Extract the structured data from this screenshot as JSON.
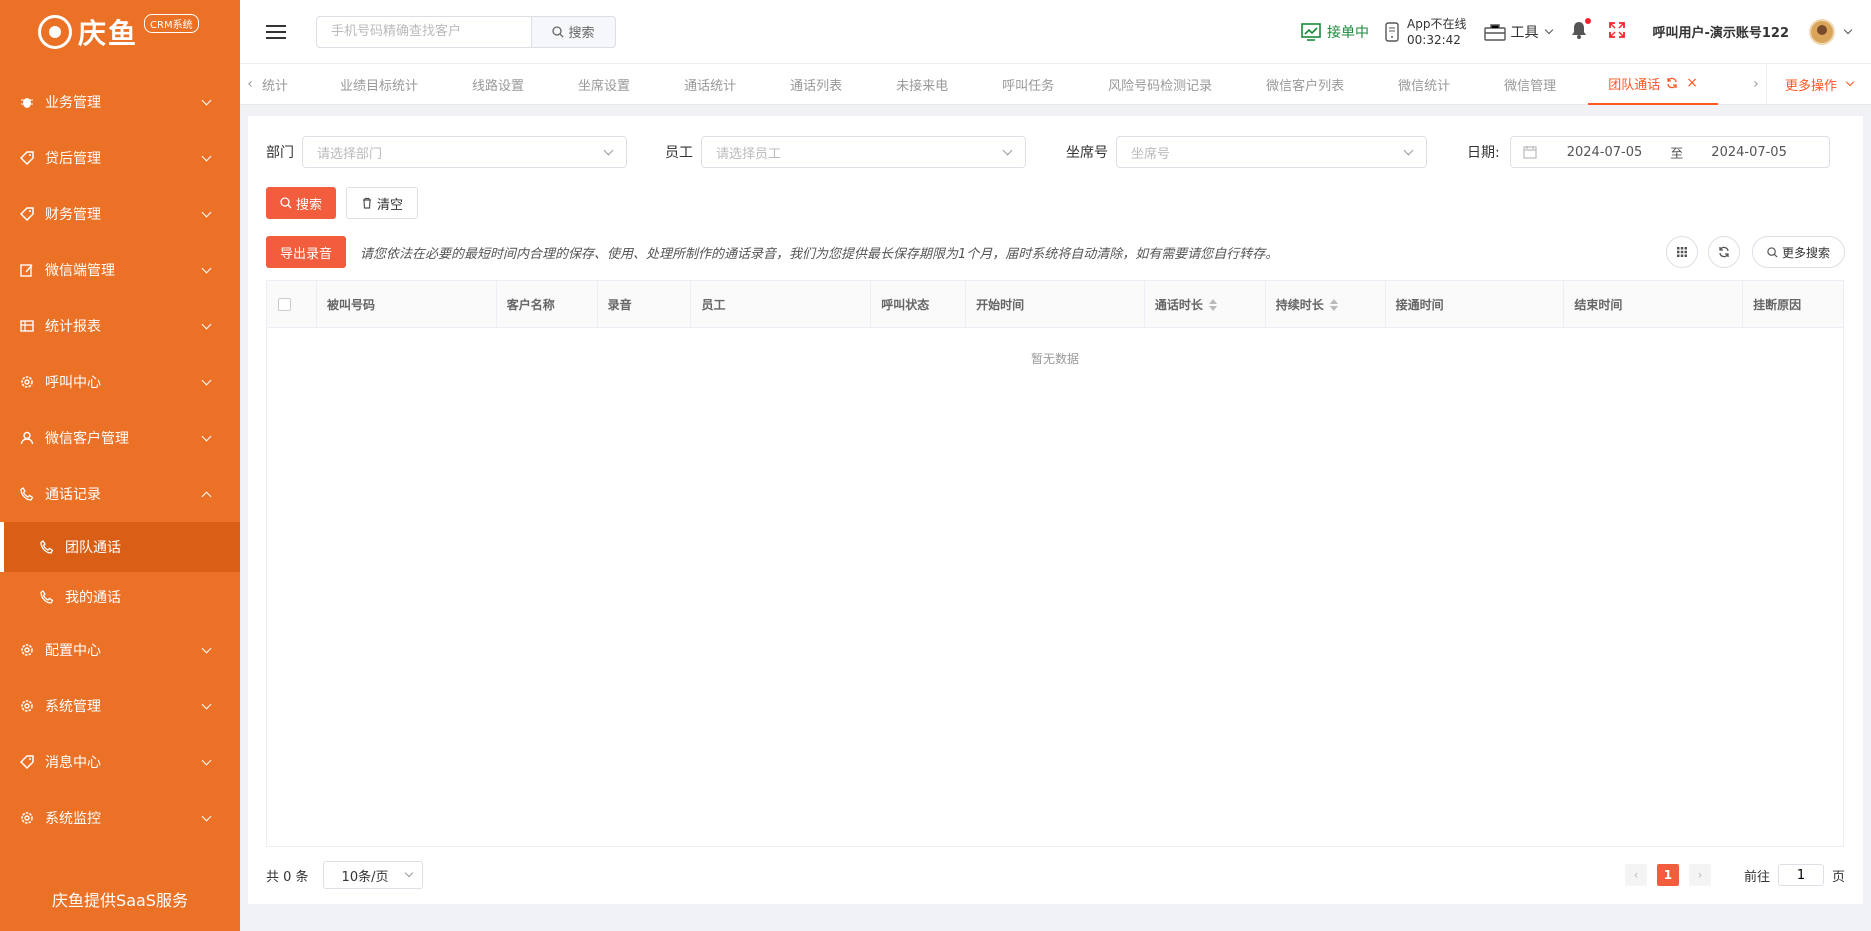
{
  "brand": {
    "name": "庆鱼",
    "badge": "CRM系统",
    "footer": "庆鱼提供SaaS服务"
  },
  "sidebar": {
    "items": [
      {
        "label": "业务管理",
        "icon": "bug-icon"
      },
      {
        "label": "贷后管理",
        "icon": "tag-icon"
      },
      {
        "label": "财务管理",
        "icon": "tag-icon"
      },
      {
        "label": "微信端管理",
        "icon": "edit-icon"
      },
      {
        "label": "统计报表",
        "icon": "table-icon"
      },
      {
        "label": "呼叫中心",
        "icon": "gear-icon"
      },
      {
        "label": "微信客户管理",
        "icon": "user-icon"
      },
      {
        "label": "通话记录",
        "icon": "phone-icon",
        "expanded": true
      },
      {
        "label": "配置中心",
        "icon": "gear-icon"
      },
      {
        "label": "系统管理",
        "icon": "gear-icon"
      },
      {
        "label": "消息中心",
        "icon": "tag-icon"
      },
      {
        "label": "系统监控",
        "icon": "gear-icon"
      }
    ],
    "subitems": [
      {
        "label": "团队通话",
        "active": true
      },
      {
        "label": "我的通话",
        "active": false
      }
    ]
  },
  "header": {
    "search_placeholder": "手机号码精确查找客户",
    "search_button": "搜索",
    "status": "接单中",
    "app_status": "App不在线",
    "app_time": "00:32:42",
    "tools": "工具",
    "user": "呼叫用户-演示账号122"
  },
  "tabs": {
    "items": [
      "统计",
      "业绩目标统计",
      "线路设置",
      "坐席设置",
      "通话统计",
      "通话列表",
      "未接来电",
      "呼叫任务",
      "风险号码检测记录",
      "微信客户列表",
      "微信统计",
      "微信管理"
    ],
    "active": "团队通话",
    "more": "更多操作"
  },
  "filters": {
    "dept_label": "部门",
    "dept_placeholder": "请选择部门",
    "staff_label": "员工",
    "staff_placeholder": "请选择员工",
    "seat_label": "坐席号",
    "seat_placeholder": "坐席号",
    "date_label": "日期:",
    "date_start": "2024-07-05",
    "date_sep": "至",
    "date_end": "2024-07-05"
  },
  "actions": {
    "search": "搜索",
    "clear": "清空",
    "export": "导出录音",
    "notice": "请您依法在必要的最短时间内合理的保存、使用、处理所制作的通话录音，我们为您提供最长保存期限为1个月，届时系统将自动清除，如有需要请您自行转存。",
    "more_search": "更多搜索"
  },
  "table": {
    "columns": [
      "被叫号码",
      "客户名称",
      "录音",
      "员工",
      "呼叫状态",
      "开始时间",
      "通话时长",
      "持续时长",
      "接通时间",
      "结束时间",
      "挂断原因"
    ],
    "empty": "暂无数据"
  },
  "pager": {
    "total": "共 0 条",
    "page_size": "10条/页",
    "current": "1",
    "goto_prefix": "前往",
    "goto_value": "1",
    "goto_suffix": "页"
  },
  "colors": {
    "sidebar": "#ea7125",
    "accent": "#f25e3d",
    "status_green": "#1a8a3a"
  }
}
